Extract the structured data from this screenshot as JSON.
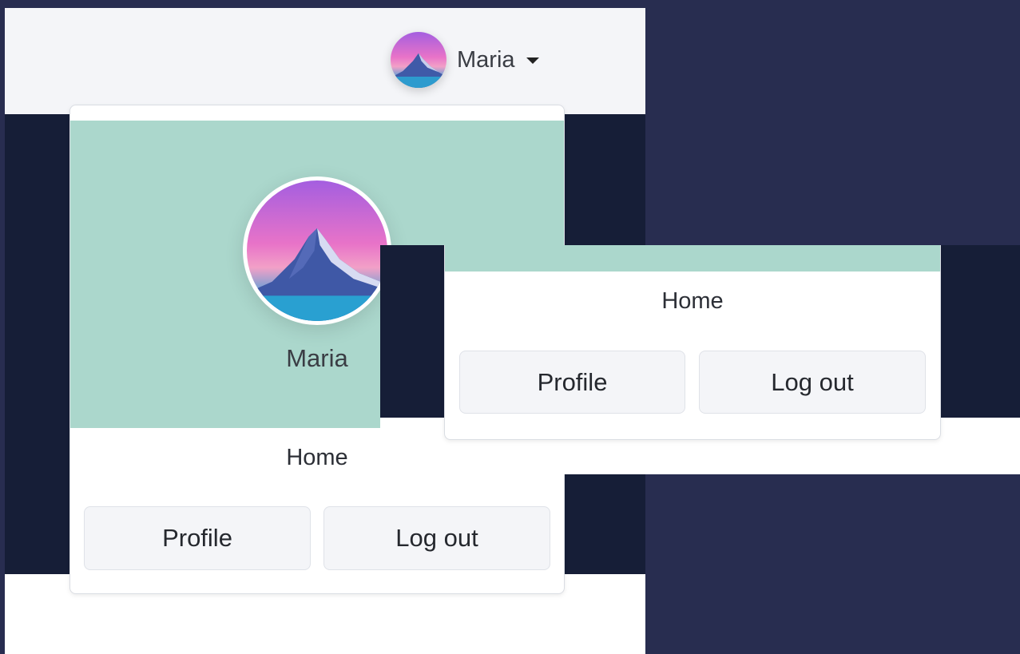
{
  "user": {
    "name": "Maria",
    "avatar_icon": "mountain-avatar"
  },
  "nav": {
    "toggle_icon": "caret-down-icon"
  },
  "dropdown": {
    "home_label": "Home",
    "profile_label": "Profile",
    "logout_label": "Log out"
  },
  "colors": {
    "page_background": "#282d50",
    "navbar": "#f4f5f8",
    "dark_band": "#161e37",
    "header_teal": "#abd7cc",
    "button_background": "#f4f5f8"
  }
}
